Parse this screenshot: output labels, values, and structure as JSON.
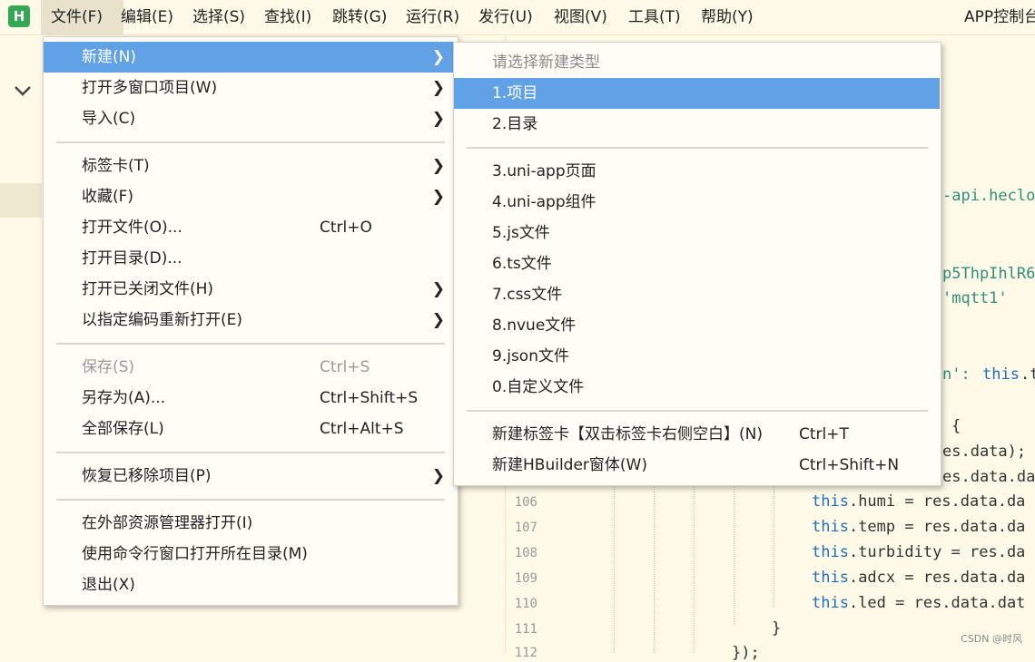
{
  "menubar": {
    "logo": "H",
    "items": [
      "文件(F)",
      "编辑(E)",
      "选择(S)",
      "查找(I)",
      "跳转(G)",
      "运行(R)",
      "发行(U)",
      "视图(V)",
      "工具(T)",
      "帮助(Y)"
    ],
    "window_title": "APP控制台"
  },
  "file_menu": {
    "new": "新建(N)",
    "open_multi_window": "打开多窗口项目(W)",
    "import": "导入(C)",
    "tabs": "标签卡(T)",
    "favorites": "收藏(F)",
    "open_file": "打开文件(O)...",
    "open_file_shortcut": "Ctrl+O",
    "open_dir": "打开目录(D)...",
    "open_closed": "打开已关闭文件(H)",
    "reopen_encoding": "以指定编码重新打开(E)",
    "save": "保存(S)",
    "save_shortcut": "Ctrl+S",
    "save_as": "另存为(A)...",
    "save_as_shortcut": "Ctrl+Shift+S",
    "save_all": "全部保存(L)",
    "save_all_shortcut": "Ctrl+Alt+S",
    "restore_removed": "恢复已移除项目(P)",
    "open_in_explorer": "在外部资源管理器打开(I)",
    "open_in_cmd": "使用命令行窗口打开所在目录(M)",
    "exit": "退出(X)"
  },
  "new_submenu": {
    "header": "请选择新建类型",
    "items": [
      "1.项目",
      "2.目录",
      "3.uni-app页面",
      "4.uni-app组件",
      "5.js文件",
      "6.ts文件",
      "7.css文件",
      "8.nvue文件",
      "9.json文件",
      "0.自定义文件"
    ],
    "new_tab": "新建标签卡【双击标签卡右侧空白】(N)",
    "new_tab_shortcut": "Ctrl+T",
    "new_window": "新建HBuilder窗体(W)",
    "new_window_shortcut": "Ctrl+Shift+N"
  },
  "editor": {
    "fragments": {
      "f1": "-api.heclo",
      "f2": "p5ThpIhlR6",
      "f3": "'mqtt1'",
      "f4": "n': ",
      "f4b": "this",
      "f4c": ".t",
      "f5": "{",
      "f6": "es.data);",
      "f7": "es.data.da"
    },
    "lines": [
      {
        "num": "106",
        "kw": "this",
        "text": ".humi = res.data.da"
      },
      {
        "num": "107",
        "kw": "this",
        "text": ".temp = res.data.da"
      },
      {
        "num": "108",
        "kw": "this",
        "text": ".turbidity = res.da"
      },
      {
        "num": "109",
        "kw": "this",
        "text": ".adcx = res.data.da"
      },
      {
        "num": "110",
        "kw": "this",
        "text": ".led = res.data.dat"
      },
      {
        "num": "111",
        "kw": "",
        "text": "}"
      },
      {
        "num": "112",
        "kw": "",
        "text": "});"
      }
    ]
  },
  "watermark": "CSDN @时风"
}
